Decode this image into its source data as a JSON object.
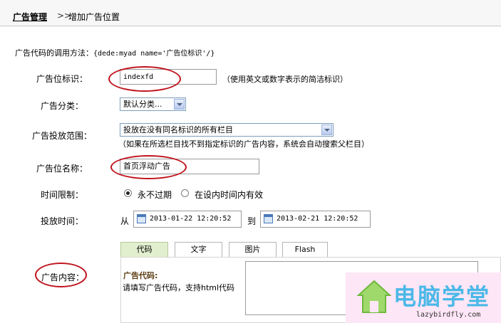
{
  "header": {
    "breadcrumb_main": "广告管理",
    "breadcrumb_sep": ">>",
    "breadcrumb_sub": "增加广告位置"
  },
  "usage": {
    "label": "广告代码的调用方法：",
    "code": "{dede:myad name='广告位标识'/}"
  },
  "form": {
    "ad_id": {
      "label": "广告位标识：",
      "value": "indexfd",
      "hint": "（使用英文或数字表示的简洁标识）"
    },
    "category": {
      "label": "广告分类：",
      "selected": "默认分类..."
    },
    "scope": {
      "label": "广告投放范围：",
      "selected": "投放在没有同名标识的所有栏目",
      "hint": "（如果在所选栏目找不到指定标识的广告内容，系统会自动搜索父栏目）"
    },
    "name": {
      "label": "广告位名称：",
      "value": "首页浮动广告"
    },
    "time_limit": {
      "label": "时间限制：",
      "option_forever": "永不过期",
      "option_period": "在设内时间内有效",
      "selected": "option_forever"
    },
    "schedule": {
      "label": "投放时间：",
      "from_label": "从",
      "from": "2013-01-22 12:20:52",
      "to_label": "到",
      "to": "2013-02-21 12:20:52"
    },
    "content": {
      "label": "广告内容：",
      "tabs": [
        "代码",
        "文字",
        "图片",
        "Flash"
      ],
      "active_tab": 0,
      "code_label": "广告代码:",
      "code_hint": "请填写广告代码，支持html代码"
    }
  },
  "watermark": {
    "text": "电脑学堂",
    "url": "lazybirdfly.com"
  },
  "colors": {
    "annotation_circle": "#c0131d",
    "active_tab_bg": "#e2efcf",
    "code_label": "#5b3c12"
  }
}
